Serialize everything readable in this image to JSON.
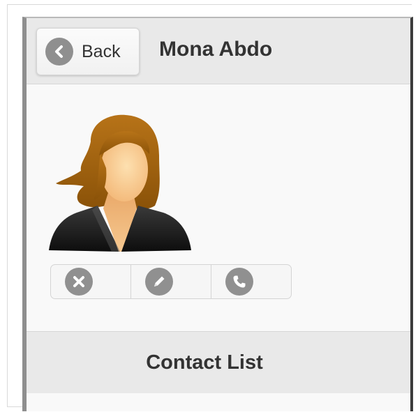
{
  "header": {
    "back_label": "Back",
    "title": "Mona Abdo"
  },
  "contact": {
    "avatar": "female-avatar"
  },
  "actions": [
    {
      "icon": "delete-icon"
    },
    {
      "icon": "edit-icon"
    },
    {
      "icon": "phone-icon"
    }
  ],
  "footer": {
    "title": "Contact List"
  },
  "colors": {
    "bar_bg": "#e9e9e9",
    "content_bg": "#f9f9f9",
    "icon_gray": "#909090",
    "text": "#333333"
  }
}
